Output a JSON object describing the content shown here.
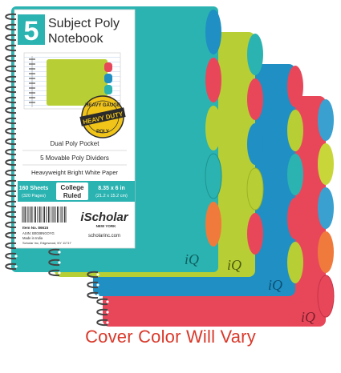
{
  "product": {
    "subject_number": "5",
    "title_line1": "Subject Poly",
    "title_line2": "Notebook",
    "badge_line1": "HEAVY GAUGE",
    "badge_line2": "HEAVY DUTY",
    "badge_line3": "POLY",
    "features": [
      "Dual Poly Pocket",
      "5 Movable Poly Dividers",
      "Heavyweight Bright White Paper"
    ],
    "sheets": "160 Sheets",
    "pages": "(320 Pages)",
    "ruling_line1": "College",
    "ruling_line2": "Ruled",
    "size": "8.35 x 6 in",
    "size_cm": "(21.2 x 15.2 cm)",
    "item_no": "Item No. 86615",
    "asin": "ASIN: B0038NGOYG",
    "made_in": "Made in India",
    "address": "Scholar Inc, Edgewood, NY 11717",
    "brand": "iScholar",
    "brand_sub": "NEW YORK",
    "website": "scholarinc.com",
    "cover_mark": "iQ"
  },
  "notebooks": [
    {
      "color": "red",
      "hex": "#e8475a"
    },
    {
      "color": "blue",
      "hex": "#1f8fc4"
    },
    {
      "color": "lime",
      "hex": "#b7cf34"
    },
    {
      "color": "teal",
      "hex": "#2bb3b1"
    }
  ],
  "caption": "Cover Color Will Vary"
}
